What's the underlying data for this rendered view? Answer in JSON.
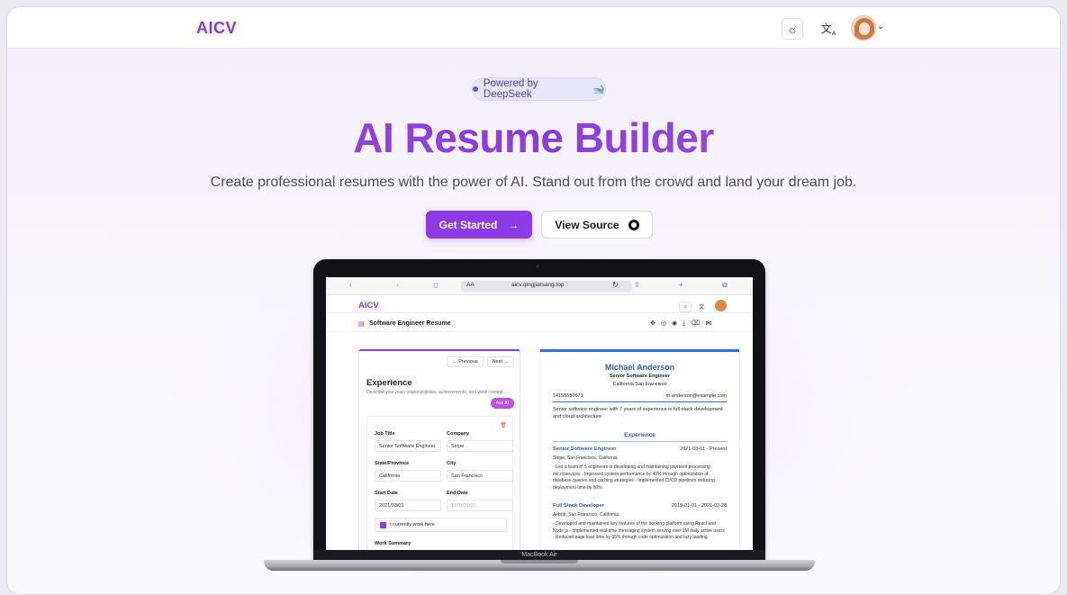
{
  "header": {
    "logo": "AICV",
    "theme_icon": "sun-icon",
    "language_icon": "translate-icon",
    "account_chevron": "⌄"
  },
  "hero": {
    "badge": "Powered by DeepSeek",
    "badge_icon": "deepseek-whale-icon",
    "title": "AI Resume Builder",
    "subtitle": "Create professional resumes with the power of AI. Stand out from the crowd and land your dream job.",
    "primary_button": "Get Started",
    "primary_button_icon": "→",
    "secondary_button": "View Source",
    "secondary_button_icon": "github-icon"
  },
  "laptop": {
    "model_label": "MacBook Air",
    "browser": {
      "aa": "AA",
      "url": "aicv.qingjiatsang.top"
    },
    "app": {
      "logo": "AICV",
      "resume_name": "Software Engineer Resume",
      "nav_previous": "← Previous",
      "nav_next": "Next →",
      "section_title": "Experience",
      "section_desc": "Describe your main responsibilities, achievements, and work content...",
      "ask_ai": "Ask AI",
      "form": {
        "job_title_label": "Job Title",
        "job_title_value": "Senior Software Engineer",
        "company_label": "Company",
        "company_value": "Stripe",
        "state_label": "State/Province",
        "state_value": "California",
        "city_label": "City",
        "city_value": "San Francisco",
        "start_label": "Start Date",
        "start_value": "2021/03/01",
        "end_label": "End Date",
        "end_placeholder": "1970/01/01",
        "current_label": "I currently work here",
        "summary_label": "Work Summary"
      },
      "preview": {
        "name": "Michael Anderson",
        "role": "Senior Software Engineer",
        "location": "California San Francisco",
        "phone": "14155552671",
        "email": "m.anderson@example.com",
        "summary": "Senior software engineer with 7 years of experience in full-stack development and cloud architecture",
        "section": "Experience",
        "jobs": [
          {
            "title": "Senior Software Engineer",
            "dates": "2021-03-01 - Present",
            "company": "Stripe, San Francisco, California",
            "bullets": "- Led a team of 5 engineers in developing and maintaining payment processing microservices - Improved system performance by 40% through optimization of database queries and caching strategies - Implemented CI/CD pipelines reducing deployment time by 60%"
          },
          {
            "title": "Full Stack Developer",
            "dates": "2019-01-01 - 2021-02-28",
            "company": "Airbnb, San Francisco, California",
            "bullets": "- Developed and maintained key features of the booking platform using React and Node.js - Implemented real-time messaging system serving over 1M daily active users - Reduced page load time by 35% through code optimization and lazy loading"
          }
        ]
      }
    }
  }
}
